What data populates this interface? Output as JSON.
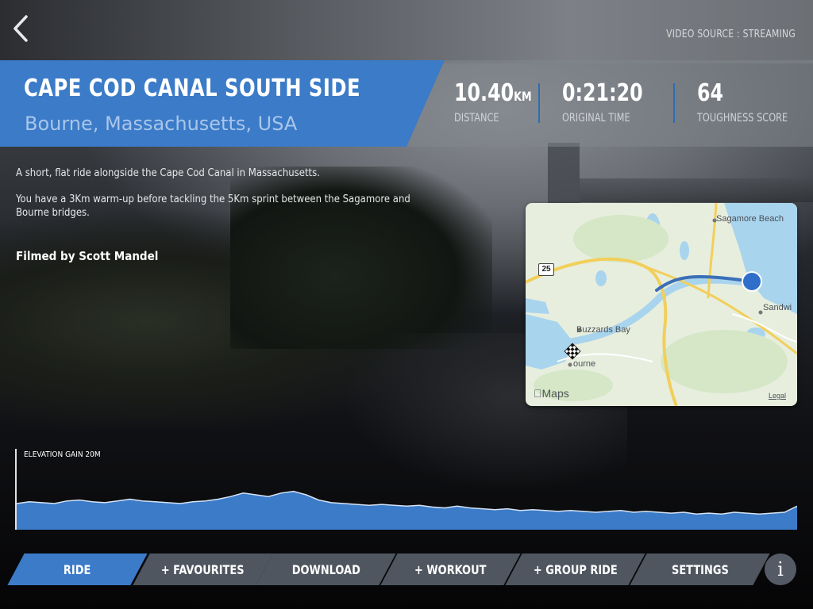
{
  "header": {
    "video_source": "VIDEO SOURCE : STREAMING"
  },
  "route": {
    "title": "CAPE COD CANAL SOUTH SIDE",
    "location": "Bourne, Massachusetts, USA",
    "stats": [
      {
        "value": "10.40",
        "unit": "KM",
        "label": "DISTANCE"
      },
      {
        "value": "0:21:20",
        "unit": "",
        "label": "ORIGINAL TIME"
      },
      {
        "value": "64",
        "unit": "",
        "label": "TOUGHNESS SCORE"
      }
    ],
    "description": [
      "A short, flat ride alongside the Cape Cod Canal in Massachusetts.",
      "You have a 3Km warm-up before tackling the 5Km sprint between the Sagamore and Bourne bridges."
    ],
    "filmed_by": "Filmed by Scott Mandel"
  },
  "map": {
    "labels": {
      "sagamore_beach": "Sagamore Beach",
      "sandwich": "Sandwi",
      "buzzards_bay": "Buzzards Bay",
      "bourne": "ourne",
      "route_shield": "25",
      "brand": "Maps",
      "legal": "Legal"
    },
    "colors": {
      "route": "#3b6fb6",
      "water": "#a9d4ee",
      "road": "#f2cf5b"
    }
  },
  "elevation": {
    "label": "ELEVATION GAIN 20M",
    "fill_color": "#3b7bc8",
    "profile": [
      0.3,
      0.32,
      0.31,
      0.3,
      0.33,
      0.34,
      0.32,
      0.31,
      0.33,
      0.35,
      0.33,
      0.32,
      0.31,
      0.3,
      0.32,
      0.33,
      0.35,
      0.38,
      0.42,
      0.4,
      0.38,
      0.42,
      0.44,
      0.4,
      0.34,
      0.31,
      0.3,
      0.29,
      0.28,
      0.29,
      0.28,
      0.27,
      0.28,
      0.26,
      0.25,
      0.27,
      0.25,
      0.24,
      0.23,
      0.24,
      0.22,
      0.23,
      0.22,
      0.21,
      0.22,
      0.21,
      0.2,
      0.21,
      0.22,
      0.2,
      0.21,
      0.2,
      0.19,
      0.2,
      0.18,
      0.19,
      0.18,
      0.2,
      0.19,
      0.18,
      0.19,
      0.2,
      0.27
    ]
  },
  "nav": {
    "buttons": [
      "RIDE",
      "+ FAVOURITES",
      "DOWNLOAD",
      "+ WORKOUT",
      "+ GROUP RIDE",
      "SETTINGS"
    ],
    "active_index": 0,
    "info_label": "i"
  }
}
